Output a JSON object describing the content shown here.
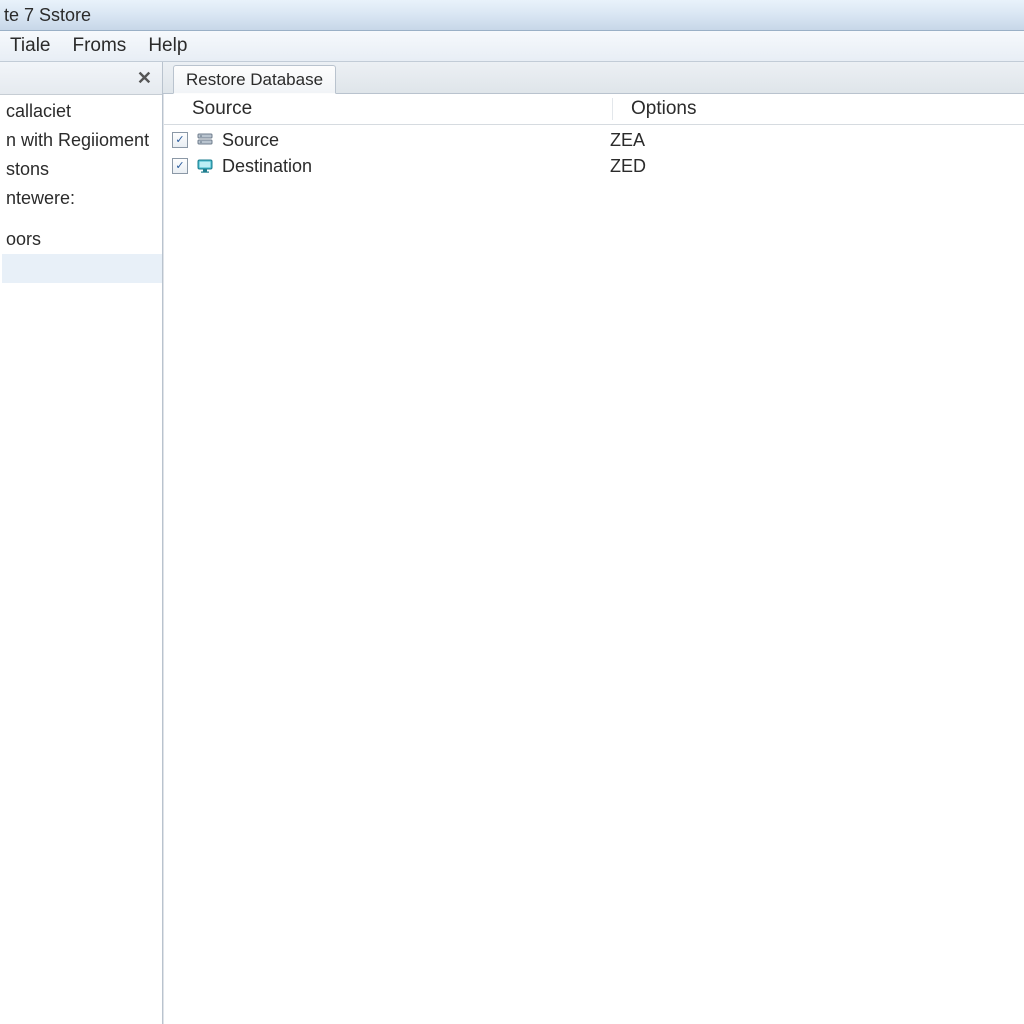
{
  "window": {
    "title": "te 7 Sstore"
  },
  "menu": {
    "items": [
      "Tiale",
      "Froms",
      "Help"
    ]
  },
  "sidebar": {
    "items": [
      "callaciet",
      "n with Regiioment",
      "stons",
      "ntewere:"
    ],
    "items2": [
      "oors"
    ]
  },
  "tabs": {
    "active": "Restore Database"
  },
  "table": {
    "headers": {
      "col1": "Source",
      "col2": "Options"
    },
    "rows": [
      {
        "checked": true,
        "icon": "server",
        "label": "Source",
        "option": "ZEA"
      },
      {
        "checked": true,
        "icon": "monitor",
        "label": "Destination",
        "option": "ZED"
      }
    ]
  }
}
